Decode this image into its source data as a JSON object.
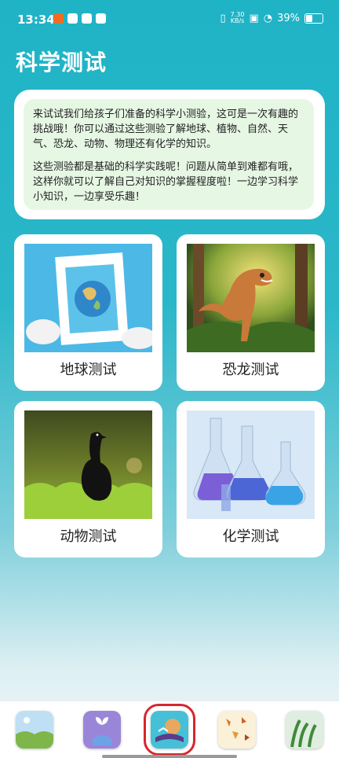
{
  "status": {
    "time": "13:34",
    "netspeed_top": "7.30",
    "netspeed_bottom": "KB/s",
    "battery": "39%"
  },
  "page": {
    "title": "科学测试"
  },
  "intro": {
    "p1": "来试试我们给孩子们准备的科学小测验，这可是一次有趣的挑战哦！你可以通过这些测验了解地球、植物、自然、天气、恐龙、动物、物理还有化学的知识。",
    "p2": "这些测验都是基础的科学实践呢！问题从简单到难都有哦，这样你就可以了解自己对知识的掌握程度啦！一边学习科学小知识，一边享受乐趣！"
  },
  "tiles": [
    {
      "label": "地球测试"
    },
    {
      "label": "恐龙测试"
    },
    {
      "label": "动物测试"
    },
    {
      "label": "化学测试"
    }
  ],
  "nav": {
    "items": [
      {
        "icon": "landscape-icon"
      },
      {
        "icon": "plant-hand-icon"
      },
      {
        "icon": "book-icon",
        "selected": true
      },
      {
        "icon": "autumn-leaves-icon"
      },
      {
        "icon": "grass-icon"
      }
    ]
  }
}
